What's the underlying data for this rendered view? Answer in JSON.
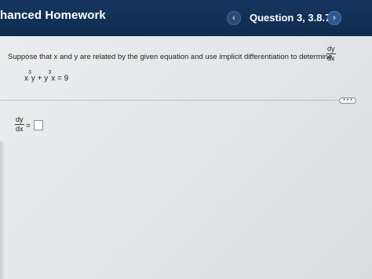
{
  "header": {
    "title": "hanced Homework",
    "question_label": "Question 3, 3.8.7",
    "prev_symbol": "‹",
    "next_symbol": "›"
  },
  "prompt": {
    "text": "Suppose that x and y are related by the given equation and use implicit differentiation to determine",
    "fraction_numerator": "dy",
    "fraction_denominator": "dx"
  },
  "equation": {
    "term1_base": "x",
    "term1_exp": "3",
    "term1_rest": "y + y",
    "term2_exp": "3",
    "term2_rest": "x = 9"
  },
  "more_button_label": "• • •",
  "answer": {
    "fraction_numerator": "dy",
    "fraction_denominator": "dx",
    "equals": "=",
    "input_value": ""
  },
  "colors": {
    "header_bg": "#0f2b4f",
    "page_bg": "#e6e8ea"
  },
  "icons": {
    "prev": "chevron-left-icon",
    "next": "chevron-right-icon"
  }
}
